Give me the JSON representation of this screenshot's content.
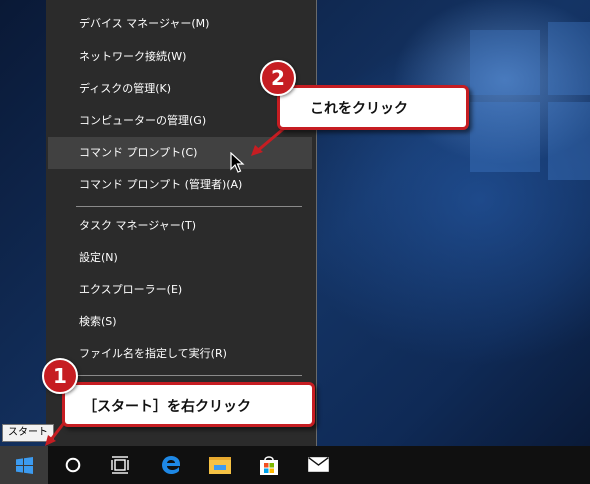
{
  "menu": {
    "items": [
      {
        "label": "デバイス マネージャー(M)",
        "highlighted": false
      },
      {
        "label": "ネットワーク接続(W)",
        "highlighted": false
      },
      {
        "label": "ディスクの管理(K)",
        "highlighted": false
      },
      {
        "label": "コンピューターの管理(G)",
        "highlighted": false
      },
      {
        "label": "コマンド プロンプト(C)",
        "highlighted": true
      },
      {
        "label": "コマンド プロンプト (管理者)(A)",
        "highlighted": false
      },
      {
        "label": "タスク マネージャー(T)",
        "highlighted": false
      },
      {
        "label": "設定(N)",
        "highlighted": false
      },
      {
        "label": "エクスプローラー(E)",
        "highlighted": false
      },
      {
        "label": "検索(S)",
        "highlighted": false
      },
      {
        "label": "ファイル名を指定して実行(R)",
        "highlighted": false
      }
    ]
  },
  "taskbar": {
    "start_tooltip": "スタート",
    "icons": [
      "windows-logo-icon",
      "cortana-circle-icon",
      "task-view-icon",
      "edge-icon",
      "file-explorer-icon",
      "store-icon",
      "mail-icon"
    ]
  },
  "annotations": {
    "step1": {
      "number": "1",
      "text": "［スタート］を右クリック"
    },
    "step2": {
      "number": "2",
      "text": "これをクリック"
    }
  },
  "colors": {
    "callout_border": "#c61d22",
    "menu_bg": "#2b2b2b",
    "menu_highlight": "#414141",
    "taskbar_bg": "#101010",
    "edge_blue": "#1e88e5",
    "explorer_yellow": "#f6c244"
  }
}
